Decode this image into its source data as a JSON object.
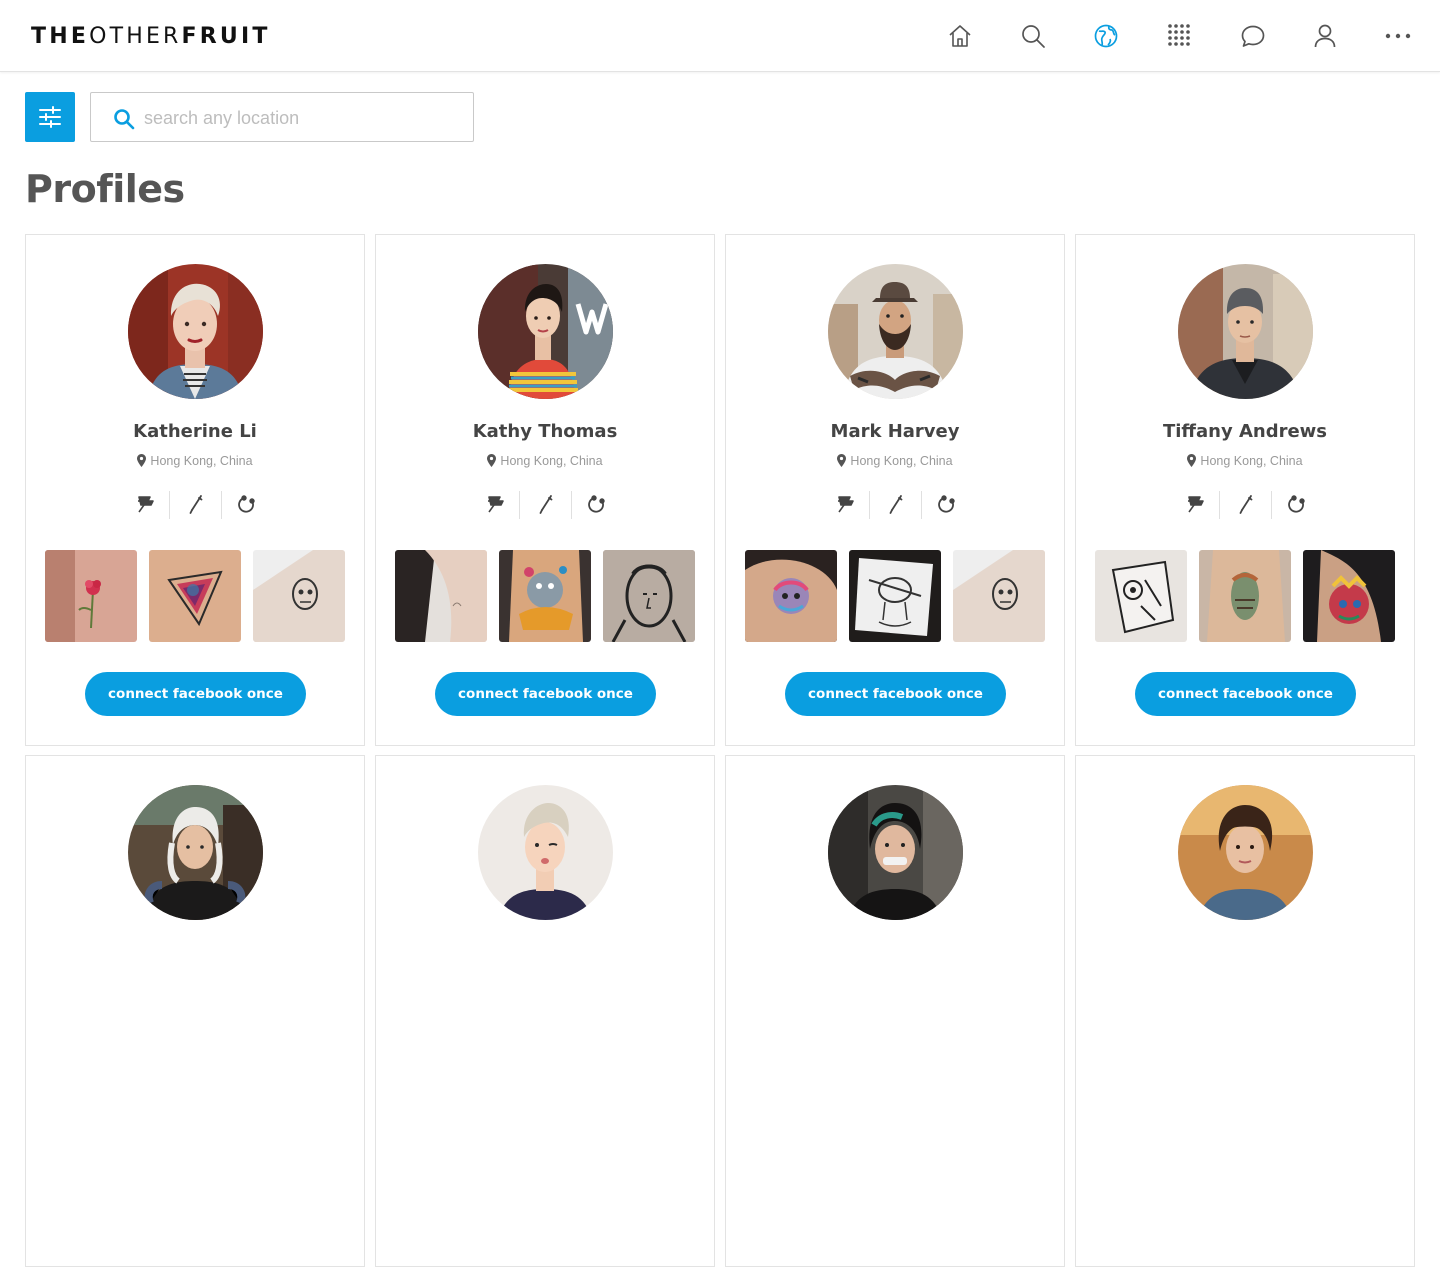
{
  "header": {
    "logo_bold_1": "THE",
    "logo_light": "OTHER",
    "logo_bold_2": "FRUIT",
    "nav": [
      {
        "name": "home-icon",
        "active": false
      },
      {
        "name": "search-icon",
        "active": false
      },
      {
        "name": "globe-icon",
        "active": true
      },
      {
        "name": "grid-icon",
        "active": false
      },
      {
        "name": "chat-icon",
        "active": false
      },
      {
        "name": "user-icon",
        "active": false
      },
      {
        "name": "more-icon",
        "active": false
      }
    ]
  },
  "toolbar": {
    "filter_icon": "sliders-icon",
    "search_placeholder": "search any location"
  },
  "page": {
    "title": "Profiles"
  },
  "colors": {
    "accent": "#0a9ee0",
    "text": "#444444",
    "muted": "#999999"
  },
  "profiles": [
    {
      "name": "Katherine Li",
      "location": "Hong Kong, China",
      "cta": "connect facebook once"
    },
    {
      "name": "Kathy Thomas",
      "location": "Hong Kong, China",
      "cta": "connect facebook once"
    },
    {
      "name": "Mark Harvey",
      "location": "Hong Kong, China",
      "cta": "connect facebook once"
    },
    {
      "name": "Tiffany Andrews",
      "location": "Hong Kong, China",
      "cta": "connect facebook once"
    },
    {
      "name": "",
      "location": "",
      "cta": ""
    },
    {
      "name": "",
      "location": "",
      "cta": ""
    },
    {
      "name": "",
      "location": "",
      "cta": ""
    },
    {
      "name": "",
      "location": "",
      "cta": ""
    }
  ],
  "card_tool_icons": [
    "tattoo-machine-icon",
    "needle-icon",
    "piercing-ring-icon"
  ]
}
